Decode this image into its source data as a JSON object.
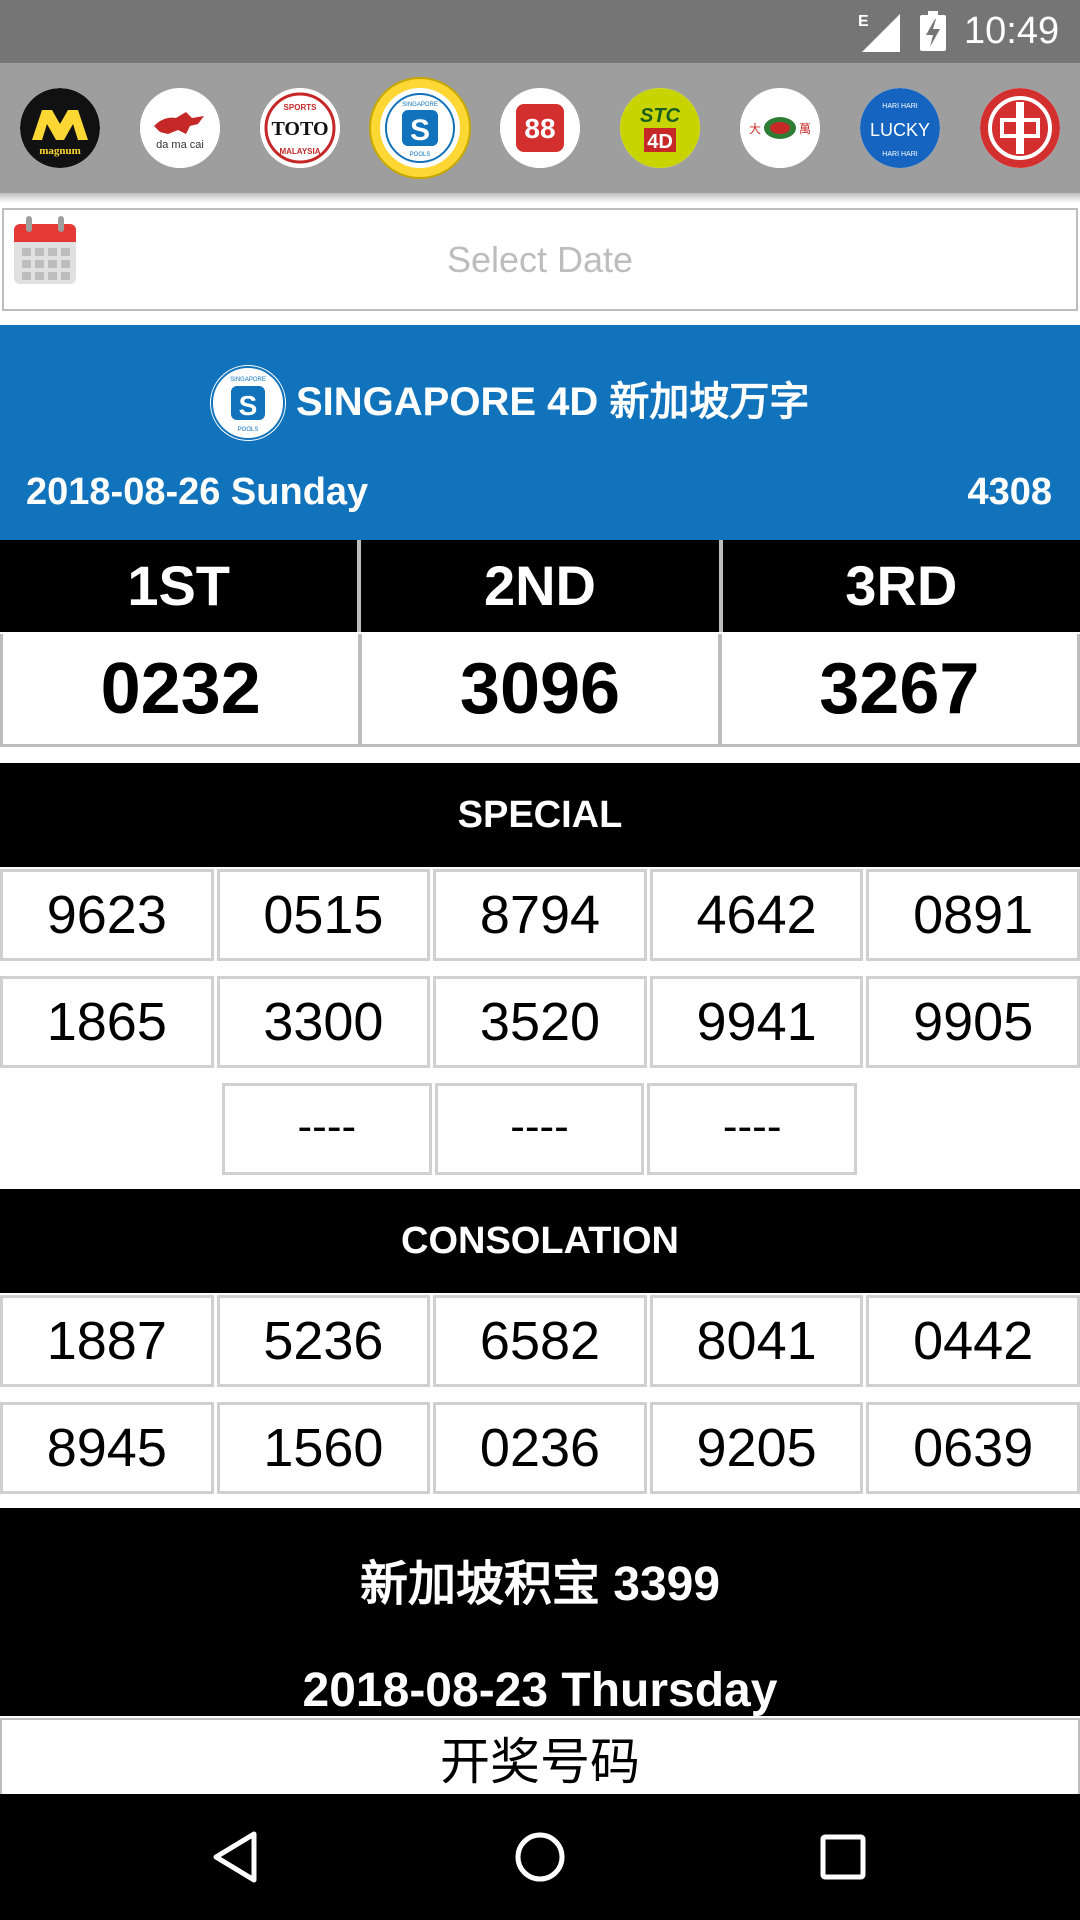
{
  "status_bar": {
    "time": "10:49",
    "network_label": "E",
    "icons": [
      "signal-icon",
      "battery-charging-icon"
    ]
  },
  "providers": [
    {
      "name": "magnum-logo",
      "label": "magnum",
      "colors": [
        "#000000",
        "#fdd835"
      ]
    },
    {
      "name": "damacai-logo",
      "label": "da ma cai",
      "colors": [
        "#ffffff",
        "#c62828"
      ]
    },
    {
      "name": "sportstoto-logo",
      "label": "TOTO",
      "sublabel_top": "SPORTS",
      "sublabel_bottom": "MALAYSIA",
      "colors": [
        "#ffffff",
        "#c62828"
      ]
    },
    {
      "name": "singapore-pools-logo",
      "label": "S",
      "sublabel_top": "SINGAPORE",
      "sublabel_bottom": "POOLS",
      "selected": true,
      "colors": [
        "#ffffff",
        "#1173bb"
      ]
    },
    {
      "name": "88-logo",
      "label": "88",
      "colors": [
        "#ffffff",
        "#d32f2f"
      ]
    },
    {
      "name": "stc-4d-logo",
      "label": "STC",
      "sublabel_bottom": "4D",
      "colors": [
        "#c8d400",
        "#1b5e20"
      ]
    },
    {
      "name": "damacai-sabah-logo",
      "label": "大 萬",
      "colors": [
        "#ffffff",
        "#c62828"
      ]
    },
    {
      "name": "lucky-hari-hari-logo",
      "label": "LUCKY",
      "sublabel_top": "HARI HARI",
      "sublabel_bottom": "HARI HARI",
      "colors": [
        "#1565c0",
        "#ffffff"
      ]
    },
    {
      "name": "sandakan-logo",
      "label": "",
      "colors": [
        "#d32f2f",
        "#ffffff"
      ]
    }
  ],
  "date_selector": {
    "placeholder": "Select Date",
    "icon": "calendar-icon"
  },
  "header": {
    "logo_top": "SINGAPORE",
    "logo_letter": "S",
    "logo_bottom": "POOLS",
    "title": "SINGAPORE 4D 新加坡万字",
    "date": "2018-08-26 Sunday",
    "draw_no": "4308",
    "background": "#1173bb"
  },
  "prizes": {
    "headers": [
      "1ST",
      "2ND",
      "3RD"
    ],
    "values": [
      "0232",
      "3096",
      "3267"
    ]
  },
  "special": {
    "label": "SPECIAL",
    "rows": [
      [
        "9623",
        "0515",
        "8794",
        "4642",
        "0891"
      ],
      [
        "1865",
        "3300",
        "3520",
        "9941",
        "9905"
      ],
      [
        "----",
        "----",
        "----"
      ]
    ]
  },
  "consolation": {
    "label": "CONSOLATION",
    "rows": [
      [
        "1887",
        "5236",
        "6582",
        "8041",
        "0442"
      ],
      [
        "8945",
        "1560",
        "0236",
        "9205",
        "0639"
      ]
    ]
  },
  "toto": {
    "title": "新加坡积宝 3399",
    "date": "2018-08-23 Thursday",
    "subheader": "开奖号码"
  },
  "nav": {
    "icons": [
      "back-icon",
      "home-icon",
      "recents-icon"
    ]
  }
}
